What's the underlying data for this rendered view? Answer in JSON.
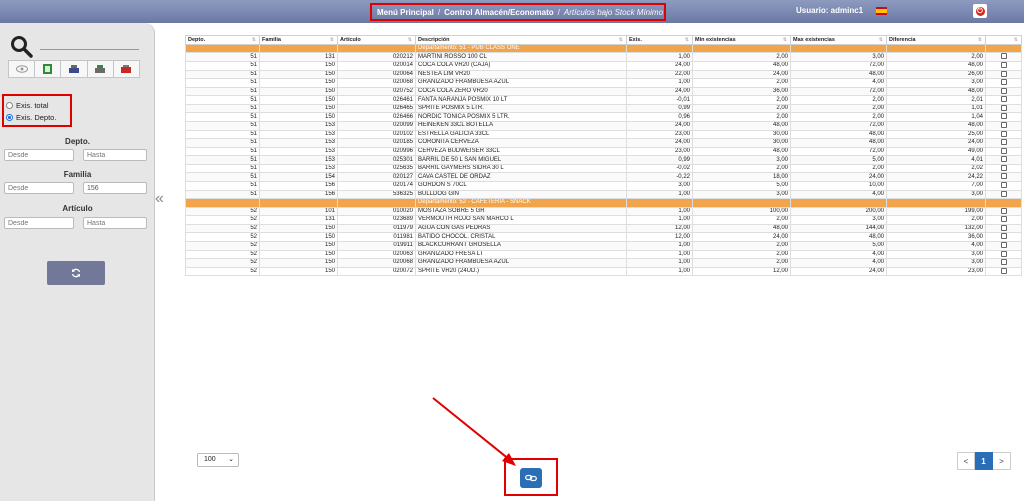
{
  "breadcrumb": {
    "item1": "Menú Principal",
    "item2": "Control Almacén/Economato",
    "item3": "Artículos bajo Stock Mínimo",
    "separator": "/"
  },
  "user": {
    "label": "Usuario: adminc1"
  },
  "sidebar": {
    "radio_total": "Exis. total",
    "radio_depto": "Exis. Depto.",
    "selected_radio": "Exis. Depto.",
    "depto": {
      "label": "Depto.",
      "from_placeholder": "Desde",
      "to_placeholder": "Hasta",
      "from_value": "",
      "to_value": ""
    },
    "familia": {
      "label": "Familia",
      "from_placeholder": "Desde",
      "to_placeholder": "",
      "from_value": "",
      "to_value": "156"
    },
    "articulo": {
      "label": "Artículo",
      "from_placeholder": "Desde",
      "to_placeholder": "Hasta",
      "from_value": "",
      "to_value": ""
    },
    "icons": [
      "eye-icon",
      "excel-icon",
      "print-icon",
      "printer-alt-icon",
      "pdf-icon"
    ]
  },
  "table": {
    "headers": [
      "Depto.",
      "Familia",
      "Artículo",
      "Descripción",
      "Exis.",
      "Min existencias",
      "Max existencias",
      "Diferencia",
      ""
    ],
    "groups": [
      {
        "label": "Departamento: 51 - PUB CLASS ONE",
        "rows": [
          [
            "51",
            "131",
            "020212",
            "MARTINI ROSSO 100 CL",
            "1,00",
            "2,00",
            "3,00",
            "2,00"
          ],
          [
            "51",
            "150",
            "020014",
            "COCA COLA VR20 (CAJA)",
            "24,00",
            "48,00",
            "72,00",
            "48,00"
          ],
          [
            "51",
            "150",
            "020064",
            "NESTEA LIM VR20",
            "22,00",
            "24,00",
            "48,00",
            "26,00"
          ],
          [
            "51",
            "150",
            "020068",
            "GRANIZADO FRAMBUESA AZUL",
            "1,00",
            "2,00",
            "4,00",
            "3,00"
          ],
          [
            "51",
            "150",
            "020752",
            "COCA COLA ZERO VR20",
            "24,00",
            "36,00",
            "72,00",
            "48,00"
          ],
          [
            "51",
            "150",
            "026461",
            "FANTA NARANJA POSMIX 10 LT",
            "-0,01",
            "2,00",
            "2,00",
            "2,01"
          ],
          [
            "51",
            "150",
            "026465",
            "SPRITE POSMIX 5 LTR.",
            "0,99",
            "2,00",
            "2,00",
            "1,01"
          ],
          [
            "51",
            "150",
            "026466",
            "NORDIC TONICA POSMIX 5 LTR.",
            "0,96",
            "2,00",
            "2,00",
            "1,04"
          ],
          [
            "51",
            "153",
            "020099",
            "HEINEKEN 33CL BOTELLA",
            "24,00",
            "48,00",
            "72,00",
            "48,00"
          ],
          [
            "51",
            "153",
            "020102",
            "ESTRELLA GALICIA 33CL",
            "23,00",
            "30,00",
            "48,00",
            "25,00"
          ],
          [
            "51",
            "153",
            "020185",
            "CORONITA CERVEZA",
            "24,00",
            "30,00",
            "48,00",
            "24,00"
          ],
          [
            "51",
            "153",
            "020996",
            "CERVEZA BUDWEISER 33CL",
            "23,00",
            "48,00",
            "72,00",
            "49,00"
          ],
          [
            "51",
            "153",
            "025301",
            "BARRIL DE 50 L SAN MIGUEL",
            "0,99",
            "3,00",
            "5,00",
            "4,01"
          ],
          [
            "51",
            "153",
            "025635",
            "BARRIL GAYMERS SIDRA 30 L",
            "-0,02",
            "2,00",
            "2,00",
            "2,02"
          ],
          [
            "51",
            "154",
            "020127",
            "CAVA CASTEL DE ORDAZ",
            "-0,22",
            "18,00",
            "24,00",
            "24,22"
          ],
          [
            "51",
            "156",
            "020174",
            "GORDON S 70CL",
            "3,00",
            "5,00",
            "10,00",
            "7,00"
          ],
          [
            "51",
            "156",
            "536325",
            "BULLDOG GIN",
            "1,00",
            "3,00",
            "4,00",
            "3,00"
          ]
        ]
      },
      {
        "label": "Departamento: 52 - CAFETERIA - SNACK",
        "rows": [
          [
            "52",
            "101",
            "010020",
            "MOSTAZA SOBRE 5 GR",
            "1,00",
            "100,00",
            "200,00",
            "199,00"
          ],
          [
            "52",
            "131",
            "023689",
            "VERMOUTH ROJO SAN MARCO L",
            "1,00",
            "2,00",
            "3,00",
            "2,00"
          ],
          [
            "52",
            "150",
            "011979",
            "AGUA CON GAS PEDRAS",
            "12,00",
            "48,00",
            "144,00",
            "132,00"
          ],
          [
            "52",
            "150",
            "011981",
            "BATIDO CHOCOL. CRISTAL",
            "12,00",
            "24,00",
            "48,00",
            "36,00"
          ],
          [
            "52",
            "150",
            "019911",
            "BLACKCURRANT GROSELLA",
            "1,00",
            "2,00",
            "5,00",
            "4,00"
          ],
          [
            "52",
            "150",
            "020063",
            "GRANIZADO FRESA LT",
            "1,00",
            "2,00",
            "4,00",
            "3,00"
          ],
          [
            "52",
            "150",
            "020068",
            "GRANIZADO FRAMBUESA AZUL",
            "1,00",
            "2,00",
            "4,00",
            "3,00"
          ],
          [
            "52",
            "150",
            "020072",
            "SPRITE VR20 (24UD.)",
            "1,00",
            "12,00",
            "24,00",
            "23,00"
          ]
        ]
      }
    ]
  },
  "footer": {
    "page_size": "100",
    "pager": {
      "prev": "<",
      "current": "1",
      "next": ">"
    }
  },
  "colors": {
    "accent": "#2a6eb8",
    "group_row": "#f2a44a",
    "highlight": "#e00000",
    "topbar": "#7a86ad"
  }
}
